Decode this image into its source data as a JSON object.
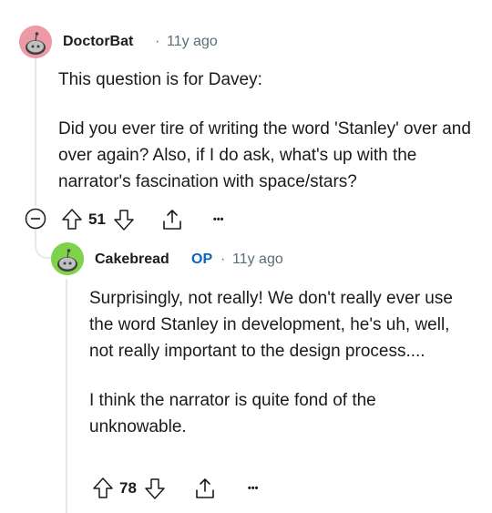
{
  "comments": [
    {
      "username": "DoctorBat",
      "separator": "·",
      "age": "11y ago",
      "paragraphs": [
        "This question is for Davey:",
        "Did you ever tire of writing the word 'Stanley' over and over again? Also, if I do ask, what's up with the narrator's fascination with space/stars?"
      ],
      "score": "51",
      "more": "•••",
      "avatar_color": "#ee99a6"
    },
    {
      "username": "Cakebread",
      "badge": "OP",
      "separator": "·",
      "age": "11y ago",
      "paragraphs": [
        "Surprisingly, not really! We don't really ever use the word Stanley in development, he's uh, well, not really important to the design process....",
        "I think the narrator is quite fond of the unknowable."
      ],
      "score": "78",
      "more": "•••",
      "avatar_color": "#7ed34a"
    }
  ],
  "icons": {
    "upvote": "upvote-arrow-icon",
    "downvote": "downvote-arrow-icon",
    "share": "share-icon",
    "collapse": "collapse-minus-icon",
    "avatar": "snoo-avatar-icon"
  }
}
